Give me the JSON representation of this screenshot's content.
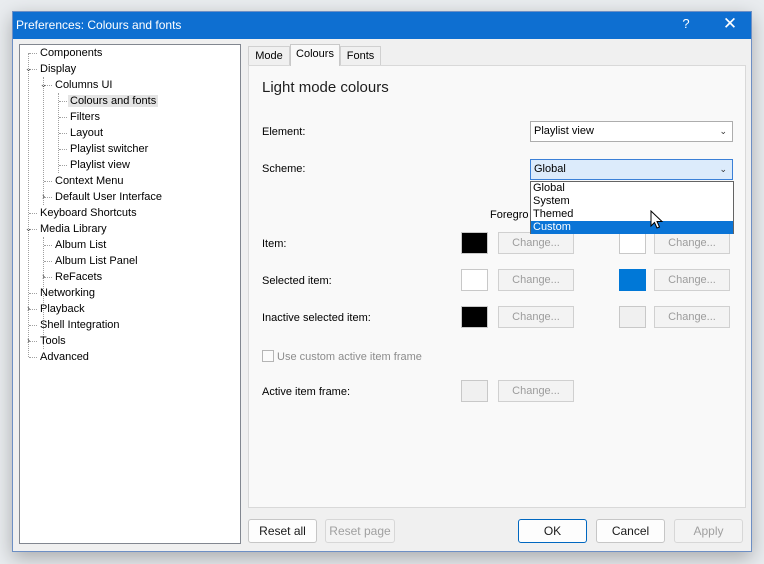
{
  "window": {
    "title": "Preferences: Colours and fonts",
    "help_glyph": "?",
    "close_glyph": "✕"
  },
  "tree": {
    "items": [
      {
        "label": "Components"
      },
      {
        "label": "Display"
      },
      {
        "label": "Columns UI"
      },
      {
        "label": "Colours and fonts"
      },
      {
        "label": "Filters"
      },
      {
        "label": "Layout"
      },
      {
        "label": "Playlist switcher"
      },
      {
        "label": "Playlist view"
      },
      {
        "label": "Context Menu"
      },
      {
        "label": "Default User Interface"
      },
      {
        "label": "Keyboard Shortcuts"
      },
      {
        "label": "Media Library"
      },
      {
        "label": "Album List"
      },
      {
        "label": "Album List Panel"
      },
      {
        "label": "ReFacets"
      },
      {
        "label": "Networking"
      },
      {
        "label": "Playback"
      },
      {
        "label": "Shell Integration"
      },
      {
        "label": "Tools"
      },
      {
        "label": "Advanced"
      }
    ]
  },
  "tabs": [
    {
      "label": "Mode"
    },
    {
      "label": "Colours"
    },
    {
      "label": "Fonts"
    }
  ],
  "panel": {
    "heading": "Light mode colours",
    "element_label": "Element:",
    "element_value": "Playlist view",
    "scheme_label": "Scheme:",
    "scheme_value": "Global",
    "scheme_options": [
      "Global",
      "System",
      "Themed",
      "Custom"
    ],
    "foreground_header": "Foregro",
    "rows": [
      {
        "label": "Item:",
        "fg_color": "#000000",
        "bg_color": "#ffffff"
      },
      {
        "label": "Selected item:",
        "fg_color": "#ffffff",
        "bg_color": "#0078d7"
      },
      {
        "label": "Inactive selected item:",
        "fg_color": "#000000",
        "bg_color": "#f0f0f0"
      }
    ],
    "change_label": "Change...",
    "custom_frame_label": "Use custom active item frame",
    "active_frame_label": "Active item frame:",
    "active_frame_color": "#f0f0f0"
  },
  "footer": {
    "reset_all": "Reset all",
    "reset_page": "Reset page",
    "ok": "OK",
    "cancel": "Cancel",
    "apply": "Apply"
  },
  "glyphs": {
    "expanded": "⌄",
    "collapsed": "›",
    "dropdown_arrow": "⌄"
  }
}
